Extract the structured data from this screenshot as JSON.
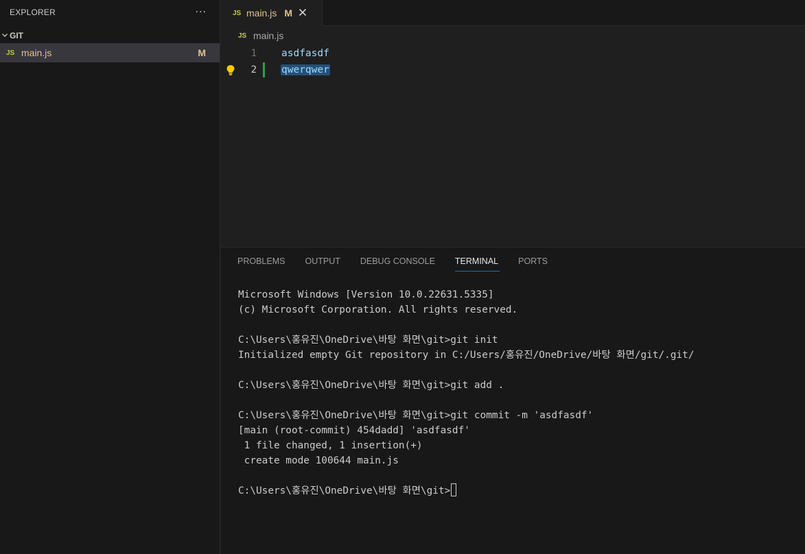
{
  "explorer": {
    "title": "EXPLORER",
    "more_icon": "ellipsis-icon",
    "folder": {
      "label": "GIT",
      "icon": "chevron-down-icon"
    },
    "files": [
      {
        "badge": "JS",
        "name": "main.js",
        "status": "M"
      }
    ]
  },
  "editor": {
    "tab": {
      "badge": "JS",
      "name": "main.js",
      "status": "M",
      "close_icon": "close-icon"
    },
    "breadcrumb": {
      "badge": "JS",
      "name": "main.js"
    },
    "lines": [
      {
        "number": "1",
        "text": "asdfasdf"
      },
      {
        "number": "2",
        "text": "qwerqwer"
      }
    ],
    "lightbulb_icon": "lightbulb-icon",
    "colors": {
      "added": "#2ea043",
      "selection": "#264f78",
      "modified": "#e2c08d"
    }
  },
  "panel": {
    "tabs": [
      "PROBLEMS",
      "OUTPUT",
      "DEBUG CONSOLE",
      "TERMINAL",
      "PORTS"
    ],
    "active_tab": "TERMINAL",
    "terminal_lines": [
      "Microsoft Windows [Version 10.0.22631.5335]",
      "(c) Microsoft Corporation. All rights reserved.",
      "",
      "C:\\Users\\홍유진\\OneDrive\\바탕 화면\\git>git init",
      "Initialized empty Git repository in C:/Users/홍유진/OneDrive/바탕 화면/git/.git/",
      "",
      "C:\\Users\\홍유진\\OneDrive\\바탕 화면\\git>git add .",
      "",
      "C:\\Users\\홍유진\\OneDrive\\바탕 화면\\git>git commit -m 'asdfasdf'",
      "[main (root-commit) 454dadd] 'asdfasdf'",
      " 1 file changed, 1 insertion(+)",
      " create mode 100644 main.js",
      ""
    ],
    "prompt": "C:\\Users\\홍유진\\OneDrive\\바탕 화면\\git>"
  }
}
